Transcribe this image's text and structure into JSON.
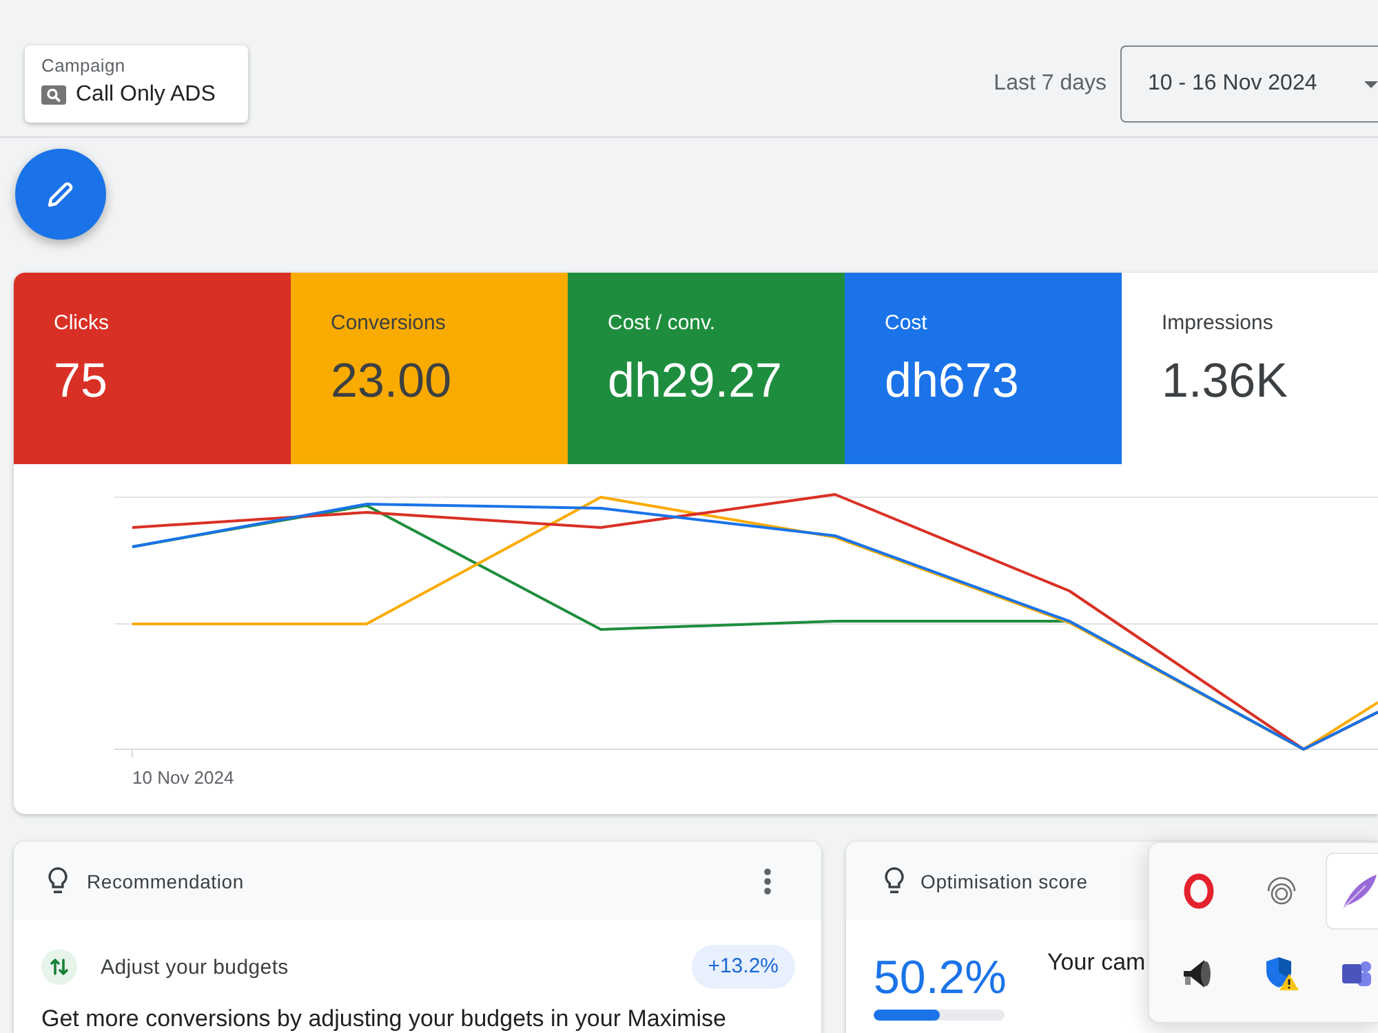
{
  "header": {
    "campaign": {
      "label": "Campaign",
      "name": "Call Only ADS"
    },
    "date_range": {
      "label": "Last 7 days",
      "value": "10 - 16 Nov 2024"
    }
  },
  "metrics": [
    {
      "label": "Clicks",
      "value": "75",
      "selected": true,
      "color": "#d93025"
    },
    {
      "label": "Conversions",
      "value": "23.00",
      "selected": true,
      "color": "#f9ab00"
    },
    {
      "label": "Cost / conv.",
      "value": "dh29.27",
      "selected": true,
      "color": "#1e8e3e"
    },
    {
      "label": "Cost",
      "value": "dh673",
      "selected": true,
      "color": "#1a73e8"
    },
    {
      "label": "Impressions",
      "value": "1.36K",
      "selected": false
    }
  ],
  "chart": {
    "x_label": "10 Nov 2024"
  },
  "recommendation": {
    "title": "Recommendation",
    "item": "Adjust your budgets",
    "uplift": "+13.2%",
    "text": "Get more conversions by adjusting your budgets in your Maximise"
  },
  "optimisation": {
    "title": "Optimisation score",
    "score": "50.2%",
    "level": 0.502,
    "text": "Your cam"
  },
  "tray": {
    "items": [
      {
        "selected": false
      },
      {
        "selected": false
      },
      {
        "selected": true
      },
      {
        "selected": false
      },
      {
        "selected": false
      },
      {
        "selected": false
      }
    ]
  }
}
